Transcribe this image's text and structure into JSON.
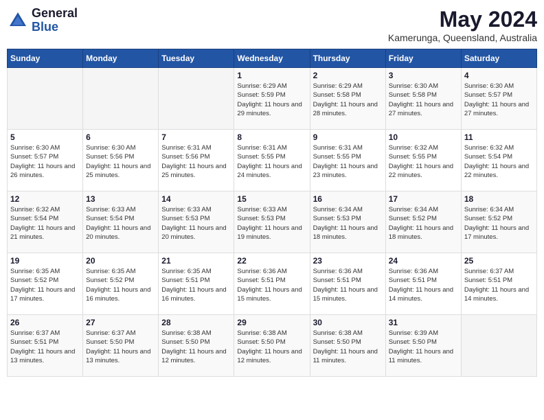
{
  "header": {
    "logo_general": "General",
    "logo_blue": "Blue",
    "month_title": "May 2024",
    "location": "Kamerunga, Queensland, Australia"
  },
  "days_of_week": [
    "Sunday",
    "Monday",
    "Tuesday",
    "Wednesday",
    "Thursday",
    "Friday",
    "Saturday"
  ],
  "weeks": [
    [
      {
        "day": "",
        "info": ""
      },
      {
        "day": "",
        "info": ""
      },
      {
        "day": "",
        "info": ""
      },
      {
        "day": "1",
        "info": "Sunrise: 6:29 AM\nSunset: 5:59 PM\nDaylight: 11 hours and 29 minutes."
      },
      {
        "day": "2",
        "info": "Sunrise: 6:29 AM\nSunset: 5:58 PM\nDaylight: 11 hours and 28 minutes."
      },
      {
        "day": "3",
        "info": "Sunrise: 6:30 AM\nSunset: 5:58 PM\nDaylight: 11 hours and 27 minutes."
      },
      {
        "day": "4",
        "info": "Sunrise: 6:30 AM\nSunset: 5:57 PM\nDaylight: 11 hours and 27 minutes."
      }
    ],
    [
      {
        "day": "5",
        "info": "Sunrise: 6:30 AM\nSunset: 5:57 PM\nDaylight: 11 hours and 26 minutes."
      },
      {
        "day": "6",
        "info": "Sunrise: 6:30 AM\nSunset: 5:56 PM\nDaylight: 11 hours and 25 minutes."
      },
      {
        "day": "7",
        "info": "Sunrise: 6:31 AM\nSunset: 5:56 PM\nDaylight: 11 hours and 25 minutes."
      },
      {
        "day": "8",
        "info": "Sunrise: 6:31 AM\nSunset: 5:55 PM\nDaylight: 11 hours and 24 minutes."
      },
      {
        "day": "9",
        "info": "Sunrise: 6:31 AM\nSunset: 5:55 PM\nDaylight: 11 hours and 23 minutes."
      },
      {
        "day": "10",
        "info": "Sunrise: 6:32 AM\nSunset: 5:55 PM\nDaylight: 11 hours and 22 minutes."
      },
      {
        "day": "11",
        "info": "Sunrise: 6:32 AM\nSunset: 5:54 PM\nDaylight: 11 hours and 22 minutes."
      }
    ],
    [
      {
        "day": "12",
        "info": "Sunrise: 6:32 AM\nSunset: 5:54 PM\nDaylight: 11 hours and 21 minutes."
      },
      {
        "day": "13",
        "info": "Sunrise: 6:33 AM\nSunset: 5:54 PM\nDaylight: 11 hours and 20 minutes."
      },
      {
        "day": "14",
        "info": "Sunrise: 6:33 AM\nSunset: 5:53 PM\nDaylight: 11 hours and 20 minutes."
      },
      {
        "day": "15",
        "info": "Sunrise: 6:33 AM\nSunset: 5:53 PM\nDaylight: 11 hours and 19 minutes."
      },
      {
        "day": "16",
        "info": "Sunrise: 6:34 AM\nSunset: 5:53 PM\nDaylight: 11 hours and 18 minutes."
      },
      {
        "day": "17",
        "info": "Sunrise: 6:34 AM\nSunset: 5:52 PM\nDaylight: 11 hours and 18 minutes."
      },
      {
        "day": "18",
        "info": "Sunrise: 6:34 AM\nSunset: 5:52 PM\nDaylight: 11 hours and 17 minutes."
      }
    ],
    [
      {
        "day": "19",
        "info": "Sunrise: 6:35 AM\nSunset: 5:52 PM\nDaylight: 11 hours and 17 minutes."
      },
      {
        "day": "20",
        "info": "Sunrise: 6:35 AM\nSunset: 5:52 PM\nDaylight: 11 hours and 16 minutes."
      },
      {
        "day": "21",
        "info": "Sunrise: 6:35 AM\nSunset: 5:51 PM\nDaylight: 11 hours and 16 minutes."
      },
      {
        "day": "22",
        "info": "Sunrise: 6:36 AM\nSunset: 5:51 PM\nDaylight: 11 hours and 15 minutes."
      },
      {
        "day": "23",
        "info": "Sunrise: 6:36 AM\nSunset: 5:51 PM\nDaylight: 11 hours and 15 minutes."
      },
      {
        "day": "24",
        "info": "Sunrise: 6:36 AM\nSunset: 5:51 PM\nDaylight: 11 hours and 14 minutes."
      },
      {
        "day": "25",
        "info": "Sunrise: 6:37 AM\nSunset: 5:51 PM\nDaylight: 11 hours and 14 minutes."
      }
    ],
    [
      {
        "day": "26",
        "info": "Sunrise: 6:37 AM\nSunset: 5:51 PM\nDaylight: 11 hours and 13 minutes."
      },
      {
        "day": "27",
        "info": "Sunrise: 6:37 AM\nSunset: 5:50 PM\nDaylight: 11 hours and 13 minutes."
      },
      {
        "day": "28",
        "info": "Sunrise: 6:38 AM\nSunset: 5:50 PM\nDaylight: 11 hours and 12 minutes."
      },
      {
        "day": "29",
        "info": "Sunrise: 6:38 AM\nSunset: 5:50 PM\nDaylight: 11 hours and 12 minutes."
      },
      {
        "day": "30",
        "info": "Sunrise: 6:38 AM\nSunset: 5:50 PM\nDaylight: 11 hours and 11 minutes."
      },
      {
        "day": "31",
        "info": "Sunrise: 6:39 AM\nSunset: 5:50 PM\nDaylight: 11 hours and 11 minutes."
      },
      {
        "day": "",
        "info": ""
      }
    ]
  ]
}
